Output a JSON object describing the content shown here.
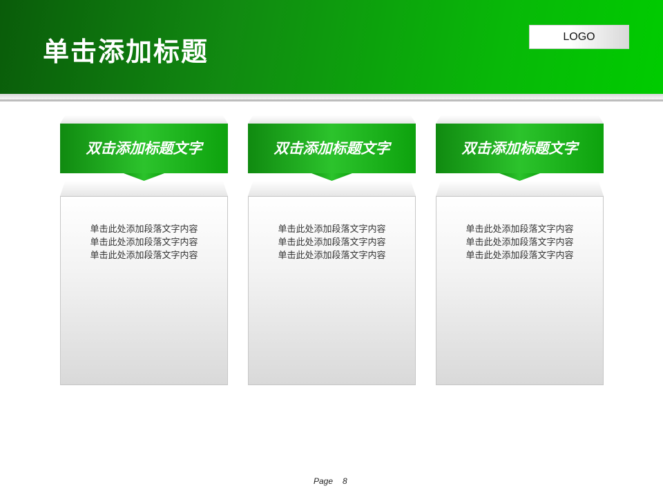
{
  "slide": {
    "title": "单击添加标题",
    "logo": "LOGO",
    "page_label": "Page",
    "page_number": "8"
  },
  "cards": [
    {
      "heading": "双击添加标题文字",
      "lines": [
        "单击此处添加段落文字内容",
        "单击此处添加段落文字内容",
        "单击此处添加段落文字内容"
      ]
    },
    {
      "heading": "双击添加标题文字",
      "lines": [
        "单击此处添加段落文字内容",
        "单击此处添加段落文字内容",
        "单击此处添加段落文字内容"
      ]
    },
    {
      "heading": "双击添加标题文字",
      "lines": [
        "单击此处添加段落文字内容",
        "单击此处添加段落文字内容",
        "单击此处添加段落文字内容"
      ]
    }
  ],
  "colors": {
    "accent": "#00b000",
    "header_dark": "#0a5c0a"
  }
}
